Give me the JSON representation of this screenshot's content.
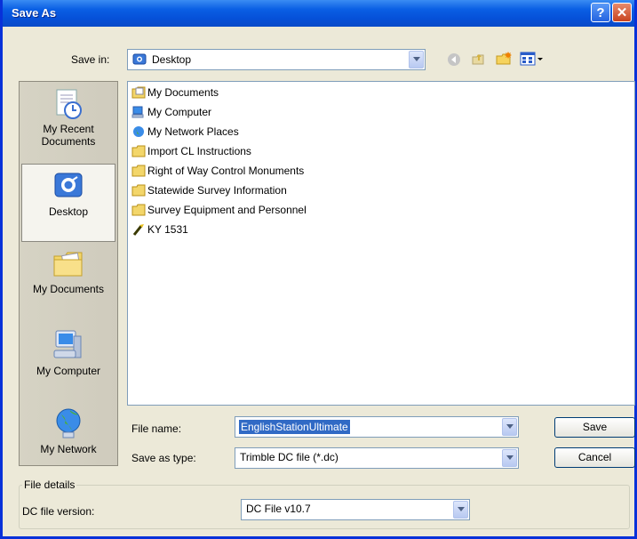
{
  "window": {
    "title": "Save As",
    "help_glyph": "?",
    "close_glyph": "✕"
  },
  "toolbar": {
    "save_in_label": "Save in:",
    "location": "Desktop"
  },
  "places": [
    {
      "line1": "My Recent",
      "line2": "Documents",
      "icon": "recent-documents-icon"
    },
    {
      "line1": "Desktop",
      "line2": "",
      "icon": "desktop-icon"
    },
    {
      "line1": "My Documents",
      "line2": "",
      "icon": "my-documents-icon"
    },
    {
      "line1": "My Computer",
      "line2": "",
      "icon": "my-computer-icon"
    },
    {
      "line1": "My Network",
      "line2": "",
      "icon": "my-network-icon"
    }
  ],
  "files": [
    {
      "name": "My Documents",
      "icon": "my-documents-icon"
    },
    {
      "name": "My Computer",
      "icon": "my-computer-icon"
    },
    {
      "name": "My Network Places",
      "icon": "network-places-icon"
    },
    {
      "name": "Import CL Instructions",
      "icon": "folder-icon"
    },
    {
      "name": "Right of Way Control Monuments",
      "icon": "folder-icon"
    },
    {
      "name": "Statewide Survey Information",
      "icon": "folder-icon"
    },
    {
      "name": "Survey Equipment and Personnel",
      "icon": "folder-icon"
    },
    {
      "name": "KY 1531",
      "icon": "shortcut-file-icon"
    }
  ],
  "form": {
    "file_name_label": "File name:",
    "file_name_value": "EnglishStationUltimate",
    "save_type_label": "Save as type:",
    "save_type_value": "Trimble DC file (*.dc)",
    "save_button": "Save",
    "cancel_button": "Cancel"
  },
  "details": {
    "group_label": "File details",
    "version_label": "DC file version:",
    "version_value": "DC File v10.7"
  },
  "colors": {
    "title_bar": "#0a5fe4",
    "selection": "#316ac5",
    "dialog_bg": "#ece9d8"
  }
}
